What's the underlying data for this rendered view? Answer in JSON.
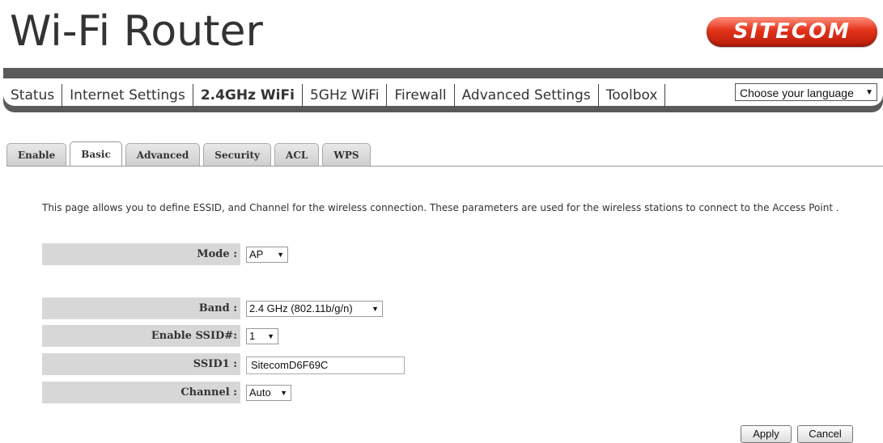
{
  "header": {
    "title": "Wi-Fi Router",
    "logo_text": "SITECOM"
  },
  "nav": {
    "items": [
      {
        "label": "Status"
      },
      {
        "label": "Internet Settings"
      },
      {
        "label": "2.4GHz WiFi"
      },
      {
        "label": "5GHz WiFi"
      },
      {
        "label": "Firewall"
      },
      {
        "label": "Advanced Settings"
      },
      {
        "label": "Toolbox"
      }
    ],
    "language_select": "Choose your language"
  },
  "tabs": [
    {
      "label": "Enable"
    },
    {
      "label": "Basic"
    },
    {
      "label": "Advanced"
    },
    {
      "label": "Security"
    },
    {
      "label": "ACL"
    },
    {
      "label": "WPS"
    }
  ],
  "description": "This page allows you to define ESSID, and Channel for the wireless connection. These parameters are used for the wireless stations to connect to the Access Point .",
  "form": {
    "mode": {
      "label": "Mode :",
      "value": "AP"
    },
    "band": {
      "label": "Band :",
      "value": "2.4 GHz (802.11b/g/n)"
    },
    "enable_ssid": {
      "label": "Enable SSID#:",
      "value": "1"
    },
    "ssid1": {
      "label": "SSID1 :",
      "value": "SitecomD6F69C"
    },
    "channel": {
      "label": "Channel :",
      "value": "Auto"
    }
  },
  "buttons": {
    "apply": "Apply",
    "cancel": "Cancel"
  },
  "colors": {
    "brand_red": "#e2321a",
    "navbar": "#5a5a5a"
  }
}
